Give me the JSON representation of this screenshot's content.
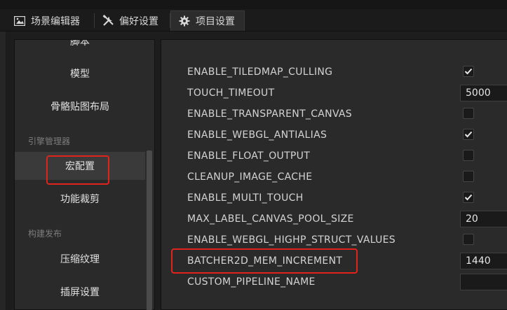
{
  "tabs": [
    {
      "label": "场景编辑器",
      "icon": "scene-editor-icon"
    },
    {
      "label": "偏好设置",
      "icon": "tools-icon"
    },
    {
      "label": "项目设置",
      "icon": "gear-icon"
    }
  ],
  "sidebar": {
    "items": [
      {
        "label": "脚本"
      },
      {
        "label": "模型"
      },
      {
        "label": "骨骼贴图布局"
      }
    ],
    "section_engine": "引擎管理器",
    "engine_items": [
      {
        "label": "宏配置"
      },
      {
        "label": "功能裁剪"
      }
    ],
    "section_build": "构建发布",
    "build_items": [
      {
        "label": "压缩纹理"
      },
      {
        "label": "插屏设置"
      }
    ]
  },
  "macros": [
    {
      "name": "ENABLE_TILEDMAP_CULLING",
      "type": "checkbox",
      "checked": true
    },
    {
      "name": "TOUCH_TIMEOUT",
      "type": "text",
      "value": "5000"
    },
    {
      "name": "ENABLE_TRANSPARENT_CANVAS",
      "type": "checkbox",
      "checked": false
    },
    {
      "name": "ENABLE_WEBGL_ANTIALIAS",
      "type": "checkbox",
      "checked": true
    },
    {
      "name": "ENABLE_FLOAT_OUTPUT",
      "type": "checkbox",
      "checked": false
    },
    {
      "name": "CLEANUP_IMAGE_CACHE",
      "type": "checkbox",
      "checked": false
    },
    {
      "name": "ENABLE_MULTI_TOUCH",
      "type": "checkbox",
      "checked": true
    },
    {
      "name": "MAX_LABEL_CANVAS_POOL_SIZE",
      "type": "text",
      "value": "20"
    },
    {
      "name": "ENABLE_WEBGL_HIGHP_STRUCT_VALUES",
      "type": "checkbox",
      "checked": false
    },
    {
      "name": "BATCHER2D_MEM_INCREMENT",
      "type": "text",
      "value": "1440"
    },
    {
      "name": "CUSTOM_PIPELINE_NAME",
      "type": "text",
      "value": ""
    }
  ],
  "colors": {
    "highlight": "#e0241c",
    "selected": "#3a3a3a"
  }
}
